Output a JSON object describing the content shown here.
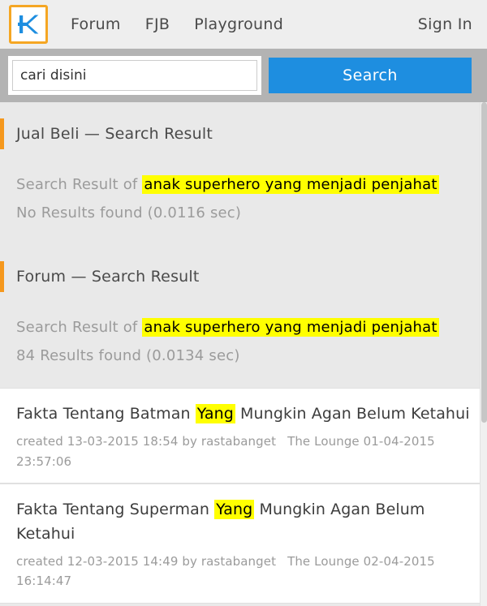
{
  "header": {
    "logo_icon": "kaskus-k-logo-icon",
    "logo_letter": "K",
    "nav_items": [
      {
        "label": "Forum"
      },
      {
        "label": "FJB"
      },
      {
        "label": "Playground"
      }
    ],
    "signin_label": "Sign In"
  },
  "search": {
    "placeholder": "cari disini",
    "value": "",
    "button_label": "Search"
  },
  "sections": [
    {
      "title": "Jual Beli — Search Result",
      "result_prefix": "Search Result of",
      "query": "anak superhero yang menjadi penjahat",
      "count_text": "No Results found (0.0116 sec)"
    },
    {
      "title": "Forum — Search Result",
      "result_prefix": "Search Result of",
      "query": "anak superhero yang menjadi penjahat",
      "count_text": "84 Results found (0.0134 sec)"
    }
  ],
  "results": [
    {
      "title_before": "Fakta Tentang Batman ",
      "title_highlight": "Yang",
      "title_after": " Mungkin Agan Belum Ketahui",
      "created_label": "created",
      "created_date": "13-03-2015 18:54",
      "by_label": "by",
      "author": "rastabanget",
      "forum": "The Lounge",
      "last_post": "01-04-2015 23:57:06"
    },
    {
      "title_before": "Fakta Tentang Superman ",
      "title_highlight": "Yang",
      "title_after": " Mungkin Agan Belum Ketahui",
      "created_label": "created",
      "created_date": "12-03-2015 14:49",
      "by_label": "by",
      "author": "rastabanget",
      "forum": "The Lounge",
      "last_post": "02-04-2015 16:14:47"
    }
  ],
  "colors": {
    "accent_orange": "#f5981d",
    "logo_border": "#f5a623",
    "logo_blue": "#1e8ee0",
    "search_button_blue": "#1e8ee0",
    "highlight_yellow": "#ffff00",
    "topbar_bg": "#eeeeee",
    "searchstrip_bg": "#b3b3b3",
    "page_bg": "#e9e9e9"
  }
}
